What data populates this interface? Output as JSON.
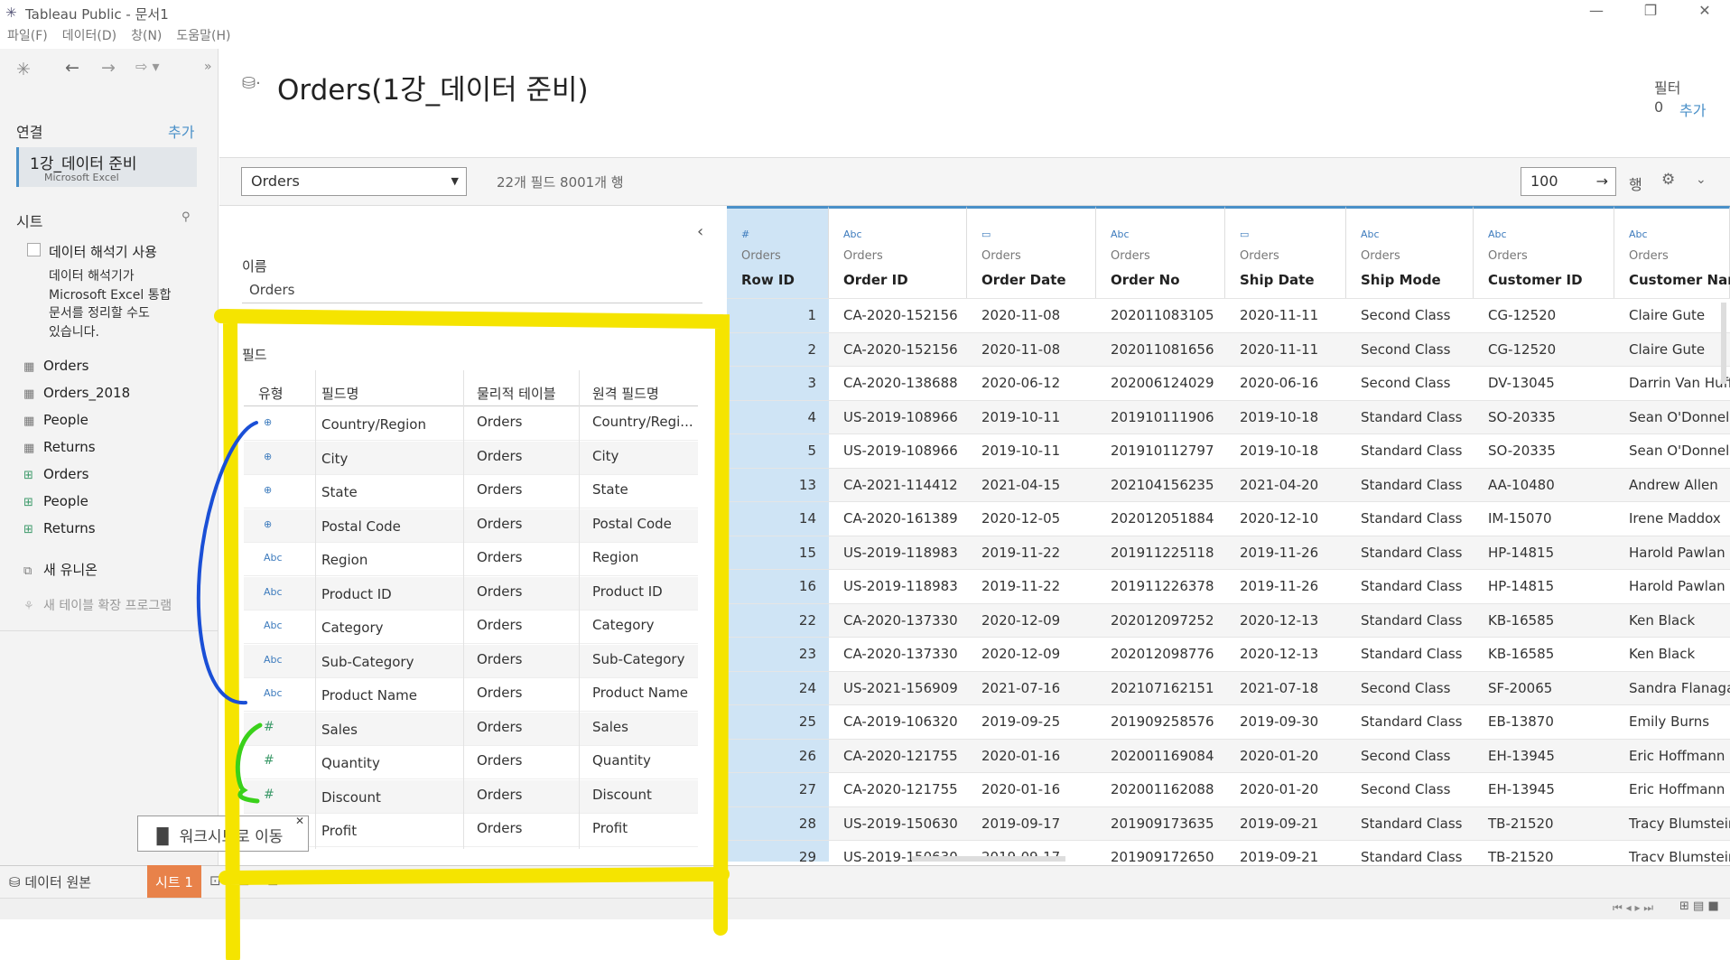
{
  "window": {
    "title": "Tableau Public - 문서1"
  },
  "menu": [
    "파일(F)",
    "데이터(D)",
    "창(N)",
    "도움말(H)"
  ],
  "left": {
    "connections_label": "연결",
    "add_label": "추가",
    "connection": {
      "name": "1강_데이터 준비",
      "type": "Microsoft Excel"
    },
    "sheets_label": "시트",
    "interpreter_label": "데이터 해석기 사용",
    "interpreter_desc": [
      "데이터 해석기가",
      "Microsoft Excel 통합",
      "문서를 정리할 수도",
      "있습니다."
    ],
    "sheets": [
      "Orders",
      "Orders_2018",
      "People",
      "Returns"
    ],
    "named_ranges": [
      "Orders",
      "People",
      "Returns"
    ],
    "new_union": "새 유니온",
    "new_extension": "새 테이블 확장 프로그램"
  },
  "header": {
    "datasource": "Orders(1강_데이터 준비)",
    "filter_label": "필터",
    "filter_count": "0",
    "filter_add": "추가"
  },
  "toolbar": {
    "table_select": "Orders",
    "meta": "22개 필드 8001개 행",
    "rows_value": "100",
    "rows_label": "행"
  },
  "metadata": {
    "name_label": "이름",
    "name_value": "Orders",
    "fields_label": "필드",
    "columns": [
      "유형",
      "필드명",
      "물리적 테이블",
      "원격 필드명"
    ],
    "rows": [
      {
        "type": "geo",
        "name": "Country/Region",
        "table": "Orders",
        "remote": "Country/Regi..."
      },
      {
        "type": "geo",
        "name": "City",
        "table": "Orders",
        "remote": "City"
      },
      {
        "type": "geo",
        "name": "State",
        "table": "Orders",
        "remote": "State"
      },
      {
        "type": "geo",
        "name": "Postal Code",
        "table": "Orders",
        "remote": "Postal Code"
      },
      {
        "type": "Abc",
        "name": "Region",
        "table": "Orders",
        "remote": "Region"
      },
      {
        "type": "Abc",
        "name": "Product ID",
        "table": "Orders",
        "remote": "Product ID"
      },
      {
        "type": "Abc",
        "name": "Category",
        "table": "Orders",
        "remote": "Category"
      },
      {
        "type": "Abc",
        "name": "Sub-Category",
        "table": "Orders",
        "remote": "Sub-Category"
      },
      {
        "type": "Abc",
        "name": "Product Name",
        "table": "Orders",
        "remote": "Product Name"
      },
      {
        "type": "#",
        "name": "Sales",
        "table": "Orders",
        "remote": "Sales"
      },
      {
        "type": "#",
        "name": "Quantity",
        "table": "Orders",
        "remote": "Quantity"
      },
      {
        "type": "#",
        "name": "Discount",
        "table": "Orders",
        "remote": "Discount"
      },
      {
        "type": "#",
        "name": "Profit",
        "table": "Orders",
        "remote": "Profit"
      }
    ]
  },
  "grid": {
    "columns": [
      {
        "type": "#",
        "source": "Orders",
        "name": "Row ID"
      },
      {
        "type": "Abc",
        "source": "Orders",
        "name": "Order ID"
      },
      {
        "type": "date",
        "source": "Orders",
        "name": "Order Date"
      },
      {
        "type": "Abc",
        "source": "Orders",
        "name": "Order No"
      },
      {
        "type": "date",
        "source": "Orders",
        "name": "Ship Date"
      },
      {
        "type": "Abc",
        "source": "Orders",
        "name": "Ship Mode"
      },
      {
        "type": "Abc",
        "source": "Orders",
        "name": "Customer ID"
      },
      {
        "type": "Abc",
        "source": "Orders",
        "name": "Customer Name"
      }
    ],
    "rows": [
      [
        "1",
        "CA-2020-152156",
        "2020-11-08",
        "202011083105",
        "2020-11-11",
        "Second Class",
        "CG-12520",
        "Claire Gute"
      ],
      [
        "2",
        "CA-2020-152156",
        "2020-11-08",
        "202011081656",
        "2020-11-11",
        "Second Class",
        "CG-12520",
        "Claire Gute"
      ],
      [
        "3",
        "CA-2020-138688",
        "2020-06-12",
        "202006124029",
        "2020-06-16",
        "Second Class",
        "DV-13045",
        "Darrin Van Huff"
      ],
      [
        "4",
        "US-2019-108966",
        "2019-10-11",
        "201910111906",
        "2019-10-18",
        "Standard Class",
        "SO-20335",
        "Sean O'Donnell"
      ],
      [
        "5",
        "US-2019-108966",
        "2019-10-11",
        "201910112797",
        "2019-10-18",
        "Standard Class",
        "SO-20335",
        "Sean O'Donnell"
      ],
      [
        "13",
        "CA-2021-114412",
        "2021-04-15",
        "202104156235",
        "2021-04-20",
        "Standard Class",
        "AA-10480",
        "Andrew Allen"
      ],
      [
        "14",
        "CA-2020-161389",
        "2020-12-05",
        "202012051884",
        "2020-12-10",
        "Standard Class",
        "IM-15070",
        "Irene Maddox"
      ],
      [
        "15",
        "US-2019-118983",
        "2019-11-22",
        "201911225118",
        "2019-11-26",
        "Standard Class",
        "HP-14815",
        "Harold Pawlan"
      ],
      [
        "16",
        "US-2019-118983",
        "2019-11-22",
        "201911226378",
        "2019-11-26",
        "Standard Class",
        "HP-14815",
        "Harold Pawlan"
      ],
      [
        "22",
        "CA-2020-137330",
        "2020-12-09",
        "202012097252",
        "2020-12-13",
        "Standard Class",
        "KB-16585",
        "Ken Black"
      ],
      [
        "23",
        "CA-2020-137330",
        "2020-12-09",
        "202012098776",
        "2020-12-13",
        "Standard Class",
        "KB-16585",
        "Ken Black"
      ],
      [
        "24",
        "US-2021-156909",
        "2021-07-16",
        "202107162151",
        "2021-07-18",
        "Second Class",
        "SF-20065",
        "Sandra Flanagan"
      ],
      [
        "25",
        "CA-2019-106320",
        "2019-09-25",
        "201909258576",
        "2019-09-30",
        "Standard Class",
        "EB-13870",
        "Emily Burns"
      ],
      [
        "26",
        "CA-2020-121755",
        "2020-01-16",
        "202001169084",
        "2020-01-20",
        "Second Class",
        "EH-13945",
        "Eric Hoffmann"
      ],
      [
        "27",
        "CA-2020-121755",
        "2020-01-16",
        "202001162088",
        "2020-01-20",
        "Second Class",
        "EH-13945",
        "Eric Hoffmann"
      ],
      [
        "28",
        "US-2019-150630",
        "2019-09-17",
        "201909173635",
        "2019-09-21",
        "Standard Class",
        "TB-21520",
        "Tracy Blumstein"
      ],
      [
        "29",
        "US-2019-150630",
        "2019-09-17",
        "201909172650",
        "2019-09-21",
        "Standard Class",
        "TB-21520",
        "Tracy Blumstein"
      ]
    ]
  },
  "bottom": {
    "datasource_tab": "데이터 원본",
    "sheet_tab": "시트 1",
    "tooltip": "워크시트로 이동"
  },
  "colors": {
    "accent": "#4a90c8",
    "sheet_tab": "#e8824a",
    "highlight_yellow": "#f5e400",
    "annot_blue": "#1a4fd6",
    "annot_green": "#3ad11a"
  }
}
